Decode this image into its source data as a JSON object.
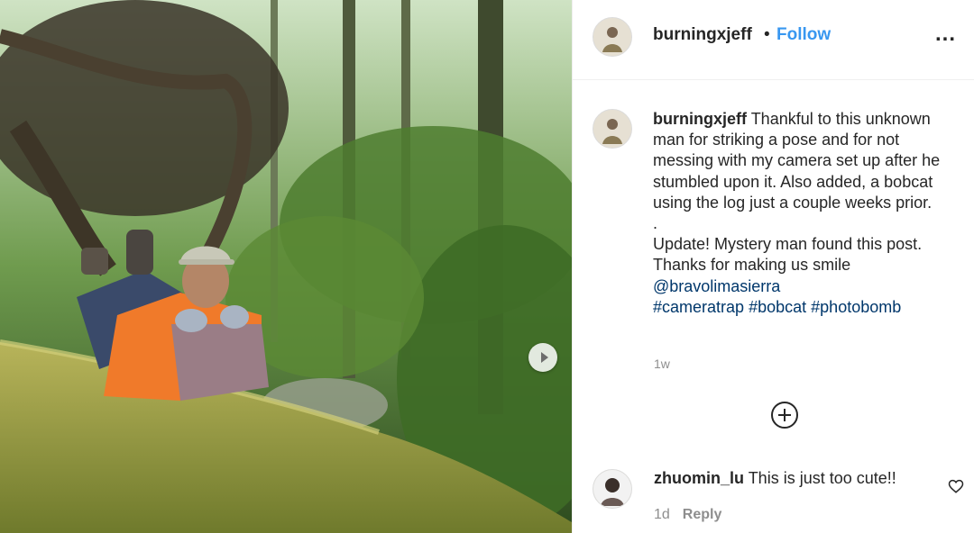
{
  "post": {
    "username": "burningxjeff",
    "dot": "•",
    "follow_label": "Follow",
    "more_label": "...",
    "caption": {
      "username": "burningxjeff",
      "text": "Thankful to this unknown man for striking a pose and for not messing with my camera set up after he stumbled upon it. Also added, a bobcat using the log just a couple weeks prior.",
      "separator": ".",
      "update": "Update! Mystery man found this post. Thanks for making us smile",
      "mention": "@bravolimasierra",
      "hashtags": [
        "#cameratrap",
        "#bobcat",
        "#photobomb"
      ]
    },
    "time": "1w"
  },
  "comment": {
    "username": "zhuomin_lu",
    "text": "This is just too cute!!",
    "time": "1d",
    "reply_label": "Reply"
  },
  "icons": {
    "carousel_next": "chevron-right-icon",
    "add_comment": "plus-circle-icon",
    "like": "heart-icon"
  },
  "colors": {
    "link": "#00376b",
    "follow": "#3897f0",
    "secondary_text": "#8e8e8e"
  }
}
